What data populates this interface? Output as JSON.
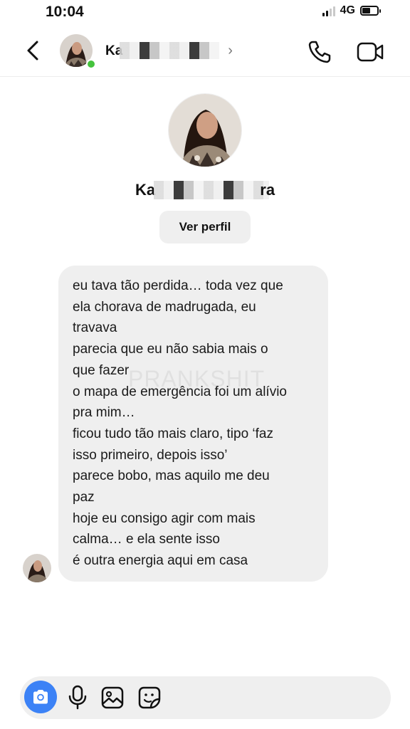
{
  "status_bar": {
    "time": "10:04",
    "network": "4G",
    "signal_bars_filled": 2,
    "signal_bars_total": 4,
    "battery_level": 0.55
  },
  "header": {
    "contact_name_visible": "Ka",
    "online": true,
    "icons": [
      "back-chevron-icon",
      "phone-icon",
      "video-camera-icon",
      "chevron-right-icon"
    ]
  },
  "profile": {
    "name_prefix": "Ka",
    "name_suffix": "ra",
    "view_profile_label": "Ver perfil"
  },
  "watermark": "PRANKSHIT",
  "message": {
    "lines": [
      "eu tava tão perdida… toda vez que",
      "ela chorava de madrugada, eu",
      "travava",
      "parecia que eu não sabia mais o",
      "que fazer",
      "o mapa de emergência foi um alívio",
      "pra mim…",
      "ficou tudo tão mais claro, tipo ‘faz",
      "isso primeiro, depois isso’",
      "parece bobo, mas aquilo me deu",
      "paz",
      "hoje eu consigo agir com mais",
      "calma… e ela sente isso",
      "é outra energia aqui em casa"
    ]
  },
  "composer": {
    "icons": [
      "camera-icon",
      "microphone-icon",
      "gallery-icon",
      "sticker-icon"
    ],
    "accent": "#3c82f6"
  },
  "colors": {
    "bubble": "#efefef",
    "online": "#45c33d",
    "accent": "#3c82f6"
  }
}
